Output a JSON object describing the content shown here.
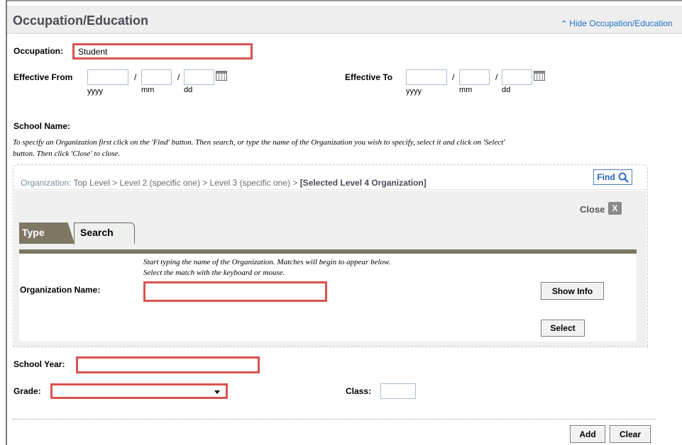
{
  "header": {
    "title": "Occupation/Education",
    "hide_link": "Hide Occupation/Education"
  },
  "occupation": {
    "label": "Occupation:",
    "value": "Student"
  },
  "effective_from": {
    "label": "Effective From",
    "sep": "/",
    "yyyy": "yyyy",
    "mm": "mm",
    "dd": "dd"
  },
  "effective_to": {
    "label": "Effective To",
    "sep": "/",
    "yyyy": "yyyy",
    "mm": "mm",
    "dd": "dd"
  },
  "school_name": {
    "label": "School Name:",
    "instructions_line1": "To specify an Organization first click on the 'Find' button. Then search, or type the name of the Organization you wish to specify, select it and click on 'Select'",
    "instructions_line2": "button. Then click 'Close' to close."
  },
  "organization": {
    "bc_label": "Organization:",
    "bc_path": "Top Level > Level 2 (specific one) > Level 3 (specific one) >",
    "bc_selected": "[Selected Level 4 Organization]",
    "find_label": "Find",
    "close_label": "Close",
    "close_x": "X",
    "tabs": {
      "type": "Type",
      "search": "Search"
    },
    "hint_line1": "Start typing the name of the Organization. Matches will begin to appear below.",
    "hint_line2": "Select the match with the keyboard or mouse.",
    "name_label": "Organization Name:",
    "name_value": "",
    "show_info": "Show Info",
    "select": "Select"
  },
  "school_year": {
    "label": "School Year:",
    "value": ""
  },
  "grade": {
    "label": "Grade:",
    "value": ""
  },
  "class": {
    "label": "Class:",
    "value": ""
  },
  "actions": {
    "add": "Add",
    "clear": "Clear"
  },
  "colors": {
    "highlight": "#d9534f",
    "link": "#1f6fc7",
    "tab_active": "#7d7763"
  }
}
